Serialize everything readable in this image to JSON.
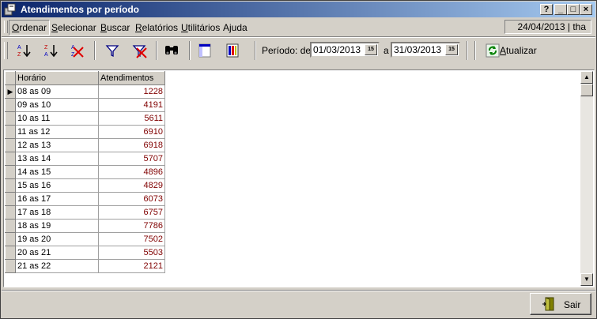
{
  "window": {
    "title": "Atendimentos por período"
  },
  "title_buttons": {
    "help": "?",
    "minimize": "_",
    "maximize": "□",
    "close": "×"
  },
  "menu": {
    "items": [
      {
        "label_u": "O",
        "label_rest": "rdenar"
      },
      {
        "label_u": "S",
        "label_rest": "elecionar"
      },
      {
        "label_u": "B",
        "label_rest": "uscar"
      },
      {
        "label_u": "R",
        "label_rest": "elatórios"
      },
      {
        "label_u": "U",
        "label_rest": "tilitários"
      },
      {
        "label_u": "",
        "label_rest": "Ajuda"
      }
    ],
    "status": "24/04/2013 | tha"
  },
  "toolbar": {
    "period_label": "Período: de",
    "date_from": "01/03/2013",
    "and_label": "a",
    "date_to": "31/03/2013",
    "calendar_label": "15",
    "refresh_u": "A",
    "refresh_rest": "tualizar"
  },
  "grid": {
    "columns": [
      "Horário",
      "Atendimentos"
    ],
    "rows": [
      {
        "horario": "08 as 09",
        "atendimentos": "1228"
      },
      {
        "horario": "09 as 10",
        "atendimentos": "4191"
      },
      {
        "horario": "10 as 11",
        "atendimentos": "5611"
      },
      {
        "horario": "11 as 12",
        "atendimentos": "6910"
      },
      {
        "horario": "12 as 13",
        "atendimentos": "6918"
      },
      {
        "horario": "13 as 14",
        "atendimentos": "5707"
      },
      {
        "horario": "14 as 15",
        "atendimentos": "4896"
      },
      {
        "horario": "15 as 16",
        "atendimentos": "4829"
      },
      {
        "horario": "16 as 17",
        "atendimentos": "6073"
      },
      {
        "horario": "17 as 18",
        "atendimentos": "6757"
      },
      {
        "horario": "18 as 19",
        "atendimentos": "7786"
      },
      {
        "horario": "19 as 20",
        "atendimentos": "7502"
      },
      {
        "horario": "20 as 21",
        "atendimentos": "5503"
      },
      {
        "horario": "21 as 22",
        "atendimentos": "2121"
      }
    ]
  },
  "footer": {
    "exit_label": "Sair"
  },
  "colors": {
    "title_start": "#0a246a",
    "title_end": "#a6caf0",
    "value_text": "#800000",
    "face": "#d4d0c8"
  }
}
